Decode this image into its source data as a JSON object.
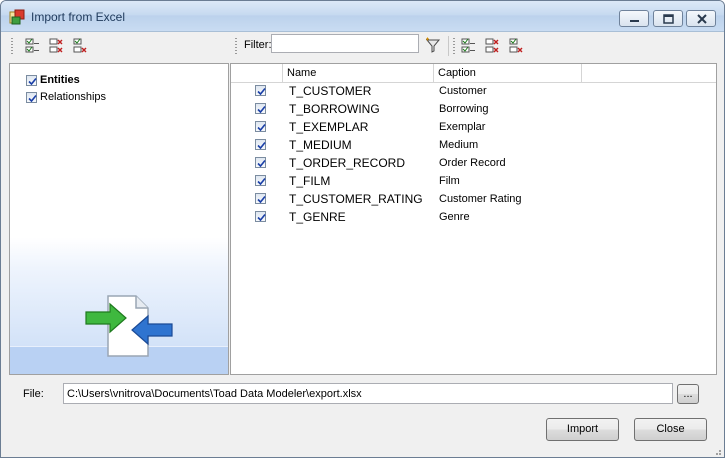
{
  "window": {
    "title": "Import from Excel"
  },
  "left_toolbar": {
    "icons": [
      "select-all-icon",
      "deselect-all-icon",
      "invert-selection-icon"
    ]
  },
  "right_toolbar": {
    "filter_label": "Filter:",
    "filter_value": "",
    "icons": [
      "filter-icon",
      "select-all-icon",
      "deselect-all-icon",
      "invert-selection-icon"
    ]
  },
  "tree": {
    "items": [
      {
        "label": "Entities",
        "checked": true,
        "selected": true
      },
      {
        "label": "Relationships",
        "checked": true,
        "selected": false
      }
    ]
  },
  "grid": {
    "columns": [
      "Name",
      "Caption"
    ],
    "rows": [
      {
        "name": "T_CUSTOMER",
        "caption": "Customer",
        "checked": true
      },
      {
        "name": "T_BORROWING",
        "caption": "Borrowing",
        "checked": true
      },
      {
        "name": "T_EXEMPLAR",
        "caption": "Exemplar",
        "checked": true
      },
      {
        "name": "T_MEDIUM",
        "caption": "Medium",
        "checked": true
      },
      {
        "name": "T_ORDER_RECORD",
        "caption": "Order Record",
        "checked": true
      },
      {
        "name": "T_FILM",
        "caption": "Film",
        "checked": true
      },
      {
        "name": "T_CUSTOMER_RATING",
        "caption": "Customer Rating",
        "checked": true
      },
      {
        "name": "T_GENRE",
        "caption": "Genre",
        "checked": true
      }
    ]
  },
  "file": {
    "label": "File:",
    "path": "C:\\Users\\vnitrova\\Documents\\Toad Data Modeler\\export.xlsx",
    "browse_label": "..."
  },
  "buttons": {
    "import": "Import",
    "close": "Close"
  },
  "colors": {
    "title_text": "#1e395b",
    "checkmark": "#1a3fa8",
    "panel_gradient_bottom": "#b9d1f3"
  }
}
